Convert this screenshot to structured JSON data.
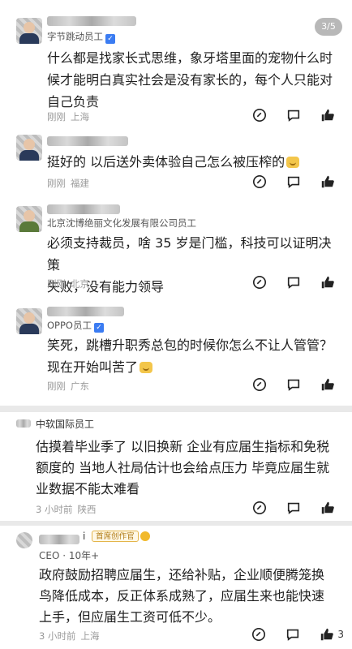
{
  "page_indicator": "3/5",
  "comments_top": [
    {
      "org": "字节跳动员工",
      "verified": true,
      "lines": [
        "什么都是找家长式思维，象牙塔里面的宠物什么时",
        "候才能明白真实社会是没有家长的，每个人只能对",
        "自己负责"
      ],
      "time": "刚刚",
      "location": "上海"
    },
    {
      "org": "",
      "verified": false,
      "lines": [
        "挺好的 以后送外卖体验自己怎么被压榨的"
      ],
      "emoji": "grin-emoji",
      "time": "刚刚",
      "location": "福建"
    },
    {
      "org": "北京沈博绝丽文化发展有限公司员工",
      "verified": false,
      "lines": [
        "必须支持裁员，啥 35 岁是门槛，科技可以证明决策",
        "失败，没有能力领导"
      ],
      "time": "刚刚",
      "location": "北京"
    },
    {
      "org": "OPPO员工",
      "verified": true,
      "lines": [
        "笑死，跳槽升职秀总包的时候你怎么不让人管管？",
        "现在开始叫苦了"
      ],
      "emoji": "grin-emoji",
      "time": "刚刚",
      "location": "广东"
    }
  ],
  "comment_mid": {
    "org": "中软国际员工",
    "lines": [
      "估摸着毕业季了 以旧换新 企业有应届生指标和免税",
      "额度的 当地人社局估计也会给点压力 毕竟应届生就",
      "业数据不能太难看"
    ],
    "time": "3 小时前",
    "location": "陕西"
  },
  "comment_bot": {
    "name_suffix": "i",
    "title_badge": "首席创作官",
    "role": "CEO · 10年+",
    "lines": [
      "政府鼓励招聘应届生，还给补贴，企业顺便腾笼换",
      "鸟降低成本，反正体系成熟了，应届生来也能快速",
      "上手，但应届生工资可低不少。"
    ],
    "time": "3 小时前",
    "location": "上海",
    "likes": "3"
  },
  "icons": {
    "reply": "reply-icon",
    "comment": "comment-icon",
    "like": "thumbs-up-icon"
  }
}
